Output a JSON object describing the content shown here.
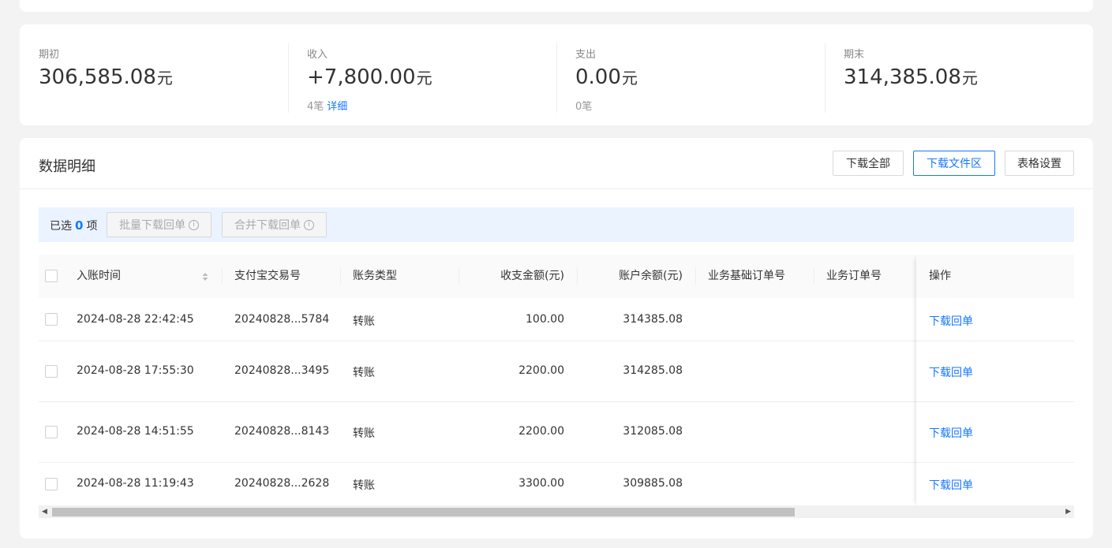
{
  "stats": [
    {
      "label": "期初",
      "value": "306,585.08",
      "unit": "元",
      "sub": "",
      "link": ""
    },
    {
      "label": "收入",
      "value": "+7,800.00",
      "unit": "元",
      "sub": "4笔",
      "link": "详细"
    },
    {
      "label": "支出",
      "value": "0.00",
      "unit": "元",
      "sub": "0笔",
      "link": ""
    },
    {
      "label": "期末",
      "value": "314,385.08",
      "unit": "元",
      "sub": "",
      "link": ""
    }
  ],
  "detail": {
    "title": "数据明细",
    "buttons": {
      "download_all": "下载全部",
      "download_files": "下载文件区",
      "table_settings": "表格设置"
    }
  },
  "selection": {
    "prefix": "已选",
    "count": "0",
    "suffix": "项",
    "batch_download": "批量下载回单",
    "merge_download": "合并下载回单",
    "info_glyph": "i"
  },
  "table": {
    "columns": [
      "入账时间",
      "支付宝交易号",
      "账务类型",
      "收支金额(元)",
      "账户余额(元)",
      "业务基础订单号",
      "业务订单号",
      "操作"
    ],
    "rows": [
      {
        "time": "2024-08-28 22:42:45",
        "trade_no": "20240828...5784",
        "type": "转账",
        "amount": "100.00",
        "balance": "314385.08",
        "base_order": "",
        "order": "",
        "action": "下载回单"
      },
      {
        "time": "2024-08-28 17:55:30",
        "trade_no": "20240828...3495",
        "type": "转账",
        "amount": "2200.00",
        "balance": "314285.08",
        "base_order": "",
        "order": "",
        "action": "下载回单"
      },
      {
        "time": "2024-08-28 14:51:55",
        "trade_no": "20240828...8143",
        "type": "转账",
        "amount": "2200.00",
        "balance": "312085.08",
        "base_order": "",
        "order": "",
        "action": "下载回单"
      },
      {
        "time": "2024-08-28 11:19:43",
        "trade_no": "20240828...2628",
        "type": "转账",
        "amount": "3300.00",
        "balance": "309885.08",
        "base_order": "",
        "order": "",
        "action": "下载回单"
      }
    ]
  },
  "scrollbar": {
    "left_arrow": "◀",
    "right_arrow": "▶"
  },
  "colors": {
    "accent": "#1677ff",
    "selection_bar": "#eaf3ff"
  }
}
